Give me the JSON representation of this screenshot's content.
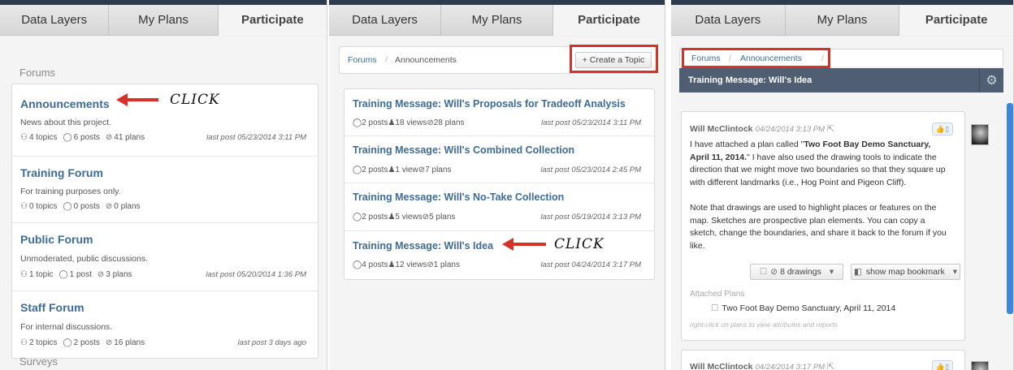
{
  "tabs": {
    "data_layers": "Data Layers",
    "my_plans": "My Plans",
    "participate": "Participate"
  },
  "panel1": {
    "forums_heading": "Forums",
    "surveys_heading": "Surveys",
    "click_label": "CLICK",
    "forums": [
      {
        "title": "Announcements",
        "desc": "News about this project.",
        "topics": "4 topics",
        "posts": "6 posts",
        "plans": "41 plans",
        "last_post": "last post 05/23/2014 3:11 PM"
      },
      {
        "title": "Training Forum",
        "desc": "For training purposes only.",
        "topics": "0 topics",
        "posts": "0 posts",
        "plans": "0 plans",
        "last_post": ""
      },
      {
        "title": "Public Forum",
        "desc": "Unmoderated, public discussions.",
        "topics": "1 topic",
        "posts": "1 post",
        "plans": "3 plans",
        "last_post": "last post 05/20/2014 1:36 PM"
      },
      {
        "title": "Staff Forum",
        "desc": "For internal discussions.",
        "topics": "2 topics",
        "posts": "2 posts",
        "plans": "16 plans",
        "last_post": "last post 3 days ago"
      }
    ]
  },
  "panel2": {
    "breadcrumb": {
      "forums": "Forums",
      "sep": "/",
      "current": "Announcements"
    },
    "create_topic": "+ Create a Topic",
    "click_label": "CLICK",
    "topics": [
      {
        "title": "Training Message: Will's Proposals for Tradeoff Analysis",
        "posts": "2 posts",
        "views": "18 views",
        "plans": "28 plans",
        "last_post": "last post 05/23/2014 3:11 PM"
      },
      {
        "title": "Training Message: Will's Combined Collection",
        "posts": "2 posts",
        "views": "1 view",
        "plans": "7 plans",
        "last_post": "last post 05/23/2014 2:45 PM"
      },
      {
        "title": "Training Message: Will's No-Take Collection",
        "posts": "2 posts",
        "views": "5 views",
        "plans": "5 plans",
        "last_post": "last post 05/19/2014 3:13 PM"
      },
      {
        "title": "Training Message: Will's Idea",
        "posts": "4 posts",
        "views": "12 views",
        "plans": "1 plans",
        "last_post": "last post 04/24/2014 3:17 PM"
      }
    ]
  },
  "panel3": {
    "breadcrumb": {
      "forums": "Forums",
      "sep": "/",
      "current": "Announcements",
      "sep2": "/"
    },
    "topic_title": "Training Message: Will's Idea",
    "message1": {
      "author": "Will McClintock",
      "date": "04/24/2014 3:13 PM",
      "p1_a": "I have attached a plan called \"",
      "p1_bold": "Two Foot Bay Demo Sanctuary, April 11, 2014.",
      "p1_b": "\" I have also used the drawing tools to indicate the direction that we might move two boundaries so that they square up with different landmarks (i.e., Hog Point and Pigeon Cliff).",
      "p2": "Note that drawings are used to highlight places or features on the map. Sketches are prospective plan elements. You can copy a sketch, change the boundaries, and share it back to the forum if you like.",
      "drawings": "8 drawings",
      "bookmark": "show map bookmark",
      "attached_label": "Attached Plans",
      "attached_plan": "Two Foot Bay Demo Sanctuary, April 11, 2014",
      "hint": "right-click on plans to view attributes and reports"
    },
    "message2": {
      "author": "Will McClintock",
      "date": "04/24/2014 3:17 PM"
    }
  },
  "colors": {
    "link": "#3e6c95",
    "highlight": "#d9302a",
    "header": "#4f5e73",
    "topbar": "#2e3b4e"
  }
}
